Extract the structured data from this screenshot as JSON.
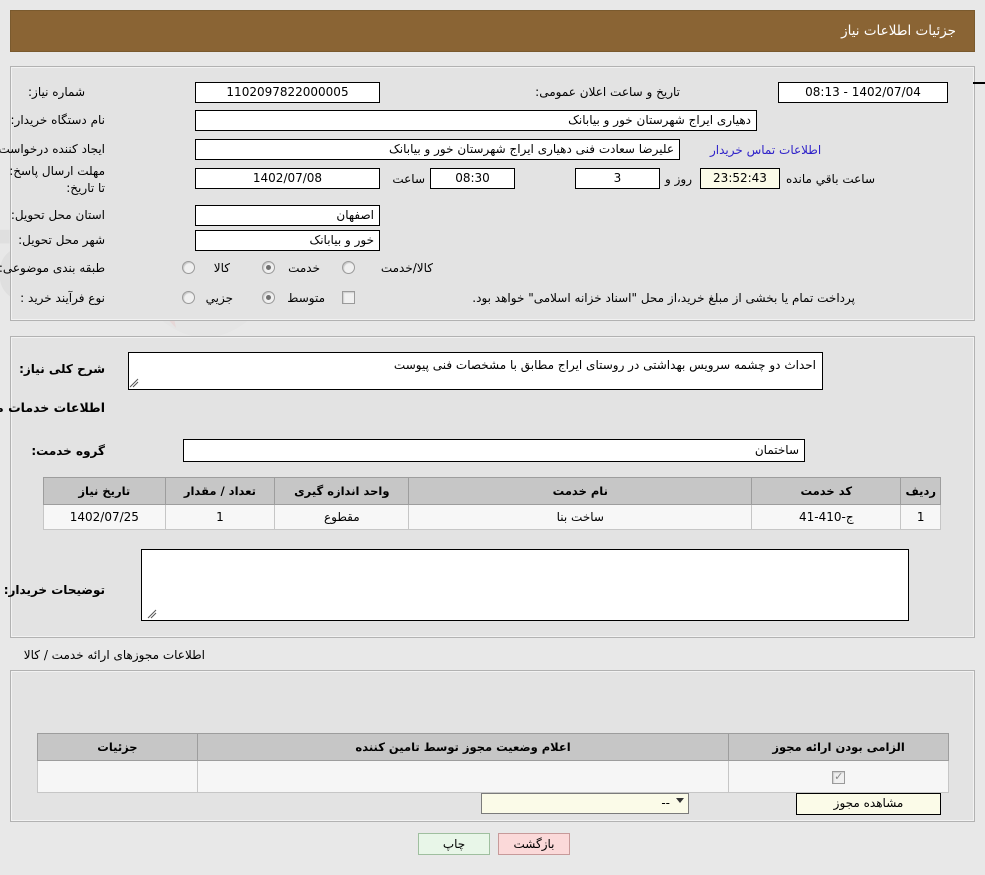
{
  "header": {
    "title": "جزئیات اطلاعات نیاز"
  },
  "top": {
    "need_number_label": "شماره نیاز:",
    "need_number_value": "1102097822000005",
    "announce_label": "تاریخ و ساعت اعلان عمومی:",
    "announce_value": "1402/07/04 - 08:13",
    "buyer_org_label": "نام دستگاه خریدار:",
    "buyer_org_value": "دهیاری ایراج شهرستان خور و بیابانک",
    "creator_label": "ایجاد کننده درخواست:",
    "creator_value": "علیرضا سعادت فنی دهیاری ایراج شهرستان خور و بیابانک",
    "contact_link": "اطلاعات تماس خریدار",
    "deadline_label": "مهلت ارسال پاسخ: تا تاریخ:",
    "deadline_date": "1402/07/08",
    "time_label": "ساعت",
    "deadline_time": "08:30",
    "days_value": "3",
    "days_unit": "روز و",
    "countdown_value": "23:52:43",
    "remaining_label": "ساعت باقي مانده",
    "province_label": "استان محل تحویل:",
    "province_value": "اصفهان",
    "city_label": "شهر محل تحویل:",
    "city_value": "خور و بیابانک",
    "category_label": "طبقه بندی موضوعی:",
    "category_options": [
      {
        "label": "کالا",
        "selected": false
      },
      {
        "label": "خدمت",
        "selected": true
      },
      {
        "label": "کالا/خدمت",
        "selected": false
      }
    ],
    "process_label": "نوع فرآیند خرید :",
    "process_options": [
      {
        "label": "جزیي",
        "selected": false
      },
      {
        "label": "متوسط",
        "selected": true
      }
    ],
    "treasury_checked": false,
    "treasury_note": "پرداخت تمام یا بخشی از مبلغ خرید،از محل \"اسناد خزانه اسلامی\" خواهد بود."
  },
  "mid": {
    "summary_label": "شرح کلی نیاز:",
    "summary_value": "احداث دو چشمه سرویس بهداشتی در روستای ایراج مطابق با مشخصات فنی پیوست",
    "services_title": "اطلاعات خدمات مورد نیاز",
    "service_group_label": "گروه خدمت:",
    "service_group_value": "ساختمان",
    "table_headers": [
      "ردیف",
      "کد خدمت",
      "نام خدمت",
      "واحد اندازه گیری",
      "تعداد / مقدار",
      "تاریخ نیاز"
    ],
    "table_rows": [
      {
        "row": "1",
        "code": "ج-410-41",
        "name": "ساخت بنا",
        "unit": "مقطوع",
        "quantity": "1",
        "date": "1402/07/25"
      }
    ],
    "buyer_notes_label": "توضیحات خریدار:",
    "buyer_notes_value": ""
  },
  "licences": {
    "caption": "اطلاعات مجوزهای ارائه خدمت / کالا",
    "headers": [
      "الزامی بودن ارائه مجوز",
      "اعلام وضعیت مجوز توسط تامین کننده",
      "جزئیات"
    ],
    "rows": [
      {
        "required_checked": true,
        "status_value": "--",
        "details_label": "مشاهده مجوز"
      }
    ]
  },
  "footer": {
    "print_label": "چاپ",
    "back_label": "بازگشت"
  },
  "watermark": {
    "text": "AriaTender.net"
  }
}
